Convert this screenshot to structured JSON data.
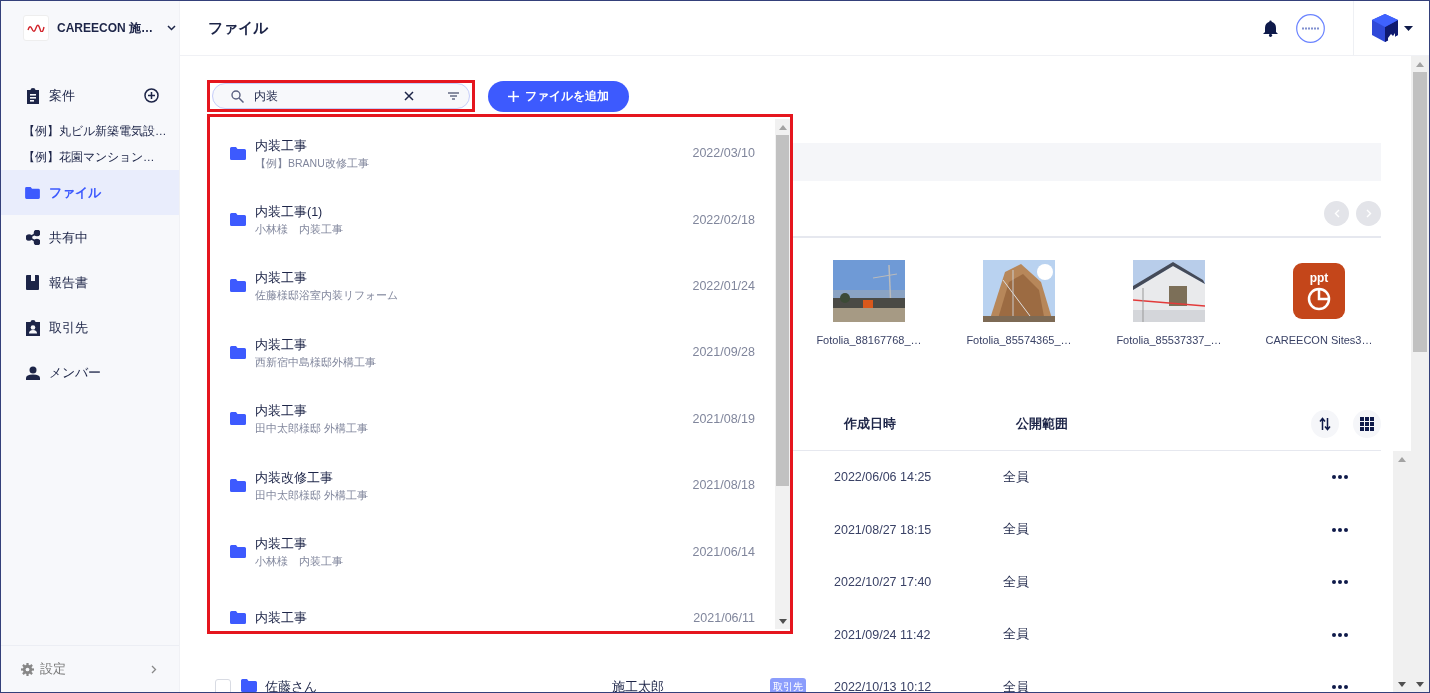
{
  "workspace": {
    "name": "CAREECON 施…"
  },
  "sidebar": {
    "items": [
      {
        "kind": "section",
        "label": "案件",
        "selected": false
      },
      {
        "kind": "project",
        "label": "【例】丸ビル新築電気設…"
      },
      {
        "kind": "project",
        "label": "【例】花園マンション…"
      },
      {
        "kind": "nav",
        "label": "ファイル",
        "selected": true
      },
      {
        "kind": "nav",
        "label": "共有中",
        "selected": false
      },
      {
        "kind": "nav",
        "label": "報告書",
        "selected": false
      },
      {
        "kind": "nav",
        "label": "取引先",
        "selected": false
      },
      {
        "kind": "nav",
        "label": "メンバー",
        "selected": false
      }
    ],
    "settings": {
      "label": "設定"
    }
  },
  "page_title": "ファイル",
  "search": {
    "value": "内装"
  },
  "add_button": {
    "label": "ファイルを追加"
  },
  "search_results": [
    {
      "title": "内装工事",
      "subtitle": "【例】BRANU改修工事",
      "date": "2022/03/10"
    },
    {
      "title": "内装工事(1)",
      "subtitle": "小林様　内装工事",
      "date": "2022/02/18"
    },
    {
      "title": "内装工事",
      "subtitle": "佐藤様邸浴室内装リフォーム",
      "date": "2022/01/24"
    },
    {
      "title": "内装工事",
      "subtitle": "西新宿中島様邸外構工事",
      "date": "2021/09/28"
    },
    {
      "title": "内装工事",
      "subtitle": "田中太郎様邸 外構工事",
      "date": "2021/08/19"
    },
    {
      "title": "内装改修工事",
      "subtitle": "田中太郎様邸 外構工事",
      "date": "2021/08/18"
    },
    {
      "title": "内装工事",
      "subtitle": "小林様　内装工事",
      "date": "2021/06/14"
    },
    {
      "title": "内装工事",
      "date": "2021/06/11"
    }
  ],
  "recent_files": [
    {
      "kind": "picture",
      "name": "Fotolia_88167768_…"
    },
    {
      "kind": "picture",
      "name": "Fotolia_85574365_…"
    },
    {
      "kind": "picture",
      "name": "Fotolia_85537337_…"
    },
    {
      "kind": "ppt",
      "badge": "ppt",
      "name": "CAREECON Sites3…"
    }
  ],
  "table": {
    "columns": [
      "作成日時",
      "公開範囲"
    ],
    "rows": [
      {
        "date": "2022/06/06 14:25",
        "visibility": "全員"
      },
      {
        "date": "2021/08/27 18:15",
        "visibility": "全員"
      },
      {
        "date": "2022/10/27 17:40",
        "visibility": "全員"
      },
      {
        "date": "2021/09/24 11:42",
        "visibility": "全員"
      },
      {
        "checked": false,
        "name": "佐藤さん",
        "owner": "施工太郎",
        "tag": "取引先",
        "date": "2022/10/13 10:12",
        "visibility": "全員"
      }
    ]
  }
}
